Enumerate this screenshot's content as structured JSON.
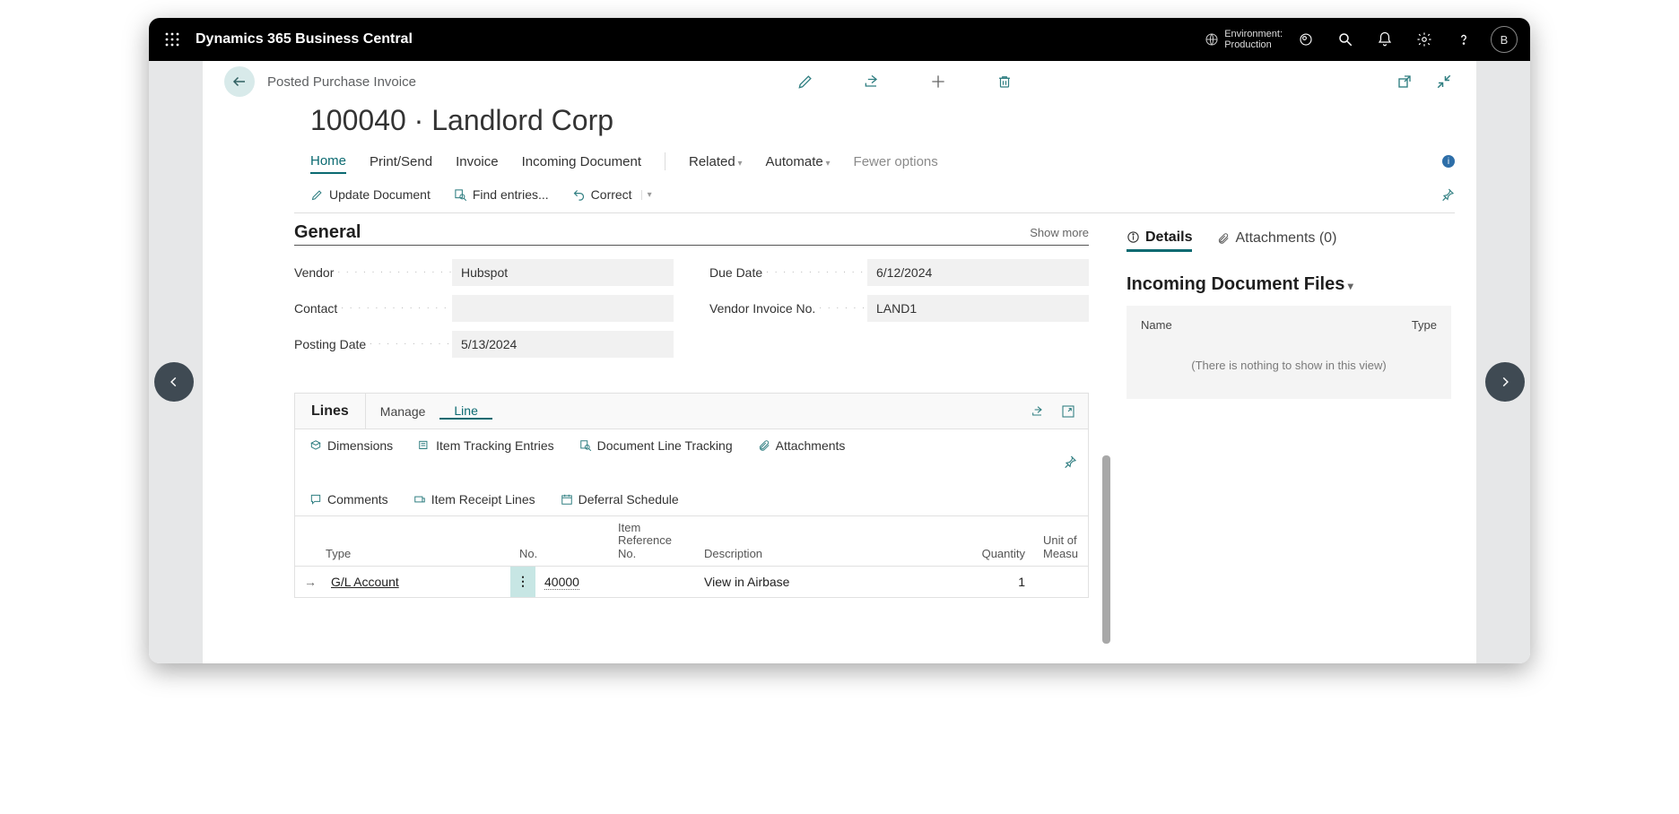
{
  "app_title": "Dynamics 365 Business Central",
  "env_label": "Environment:",
  "env_value": "Production",
  "avatar_letter": "B",
  "doc": {
    "type": "Posted Purchase Invoice",
    "title": "100040 · Landlord Corp"
  },
  "ribbon": {
    "home": "Home",
    "print_send": "Print/Send",
    "invoice": "Invoice",
    "incoming": "Incoming Document",
    "related": "Related",
    "automate": "Automate",
    "fewer": "Fewer options"
  },
  "subribbon": {
    "update": "Update Document",
    "find": "Find entries...",
    "correct": "Correct"
  },
  "general": {
    "title": "General",
    "show_more": "Show more",
    "vendor_label": "Vendor",
    "vendor_value": "Hubspot",
    "contact_label": "Contact",
    "contact_value": "",
    "posting_label": "Posting Date",
    "posting_value": "5/13/2024",
    "due_label": "Due Date",
    "due_value": "6/12/2024",
    "vinv_label": "Vendor Invoice No.",
    "vinv_value": "LAND1"
  },
  "lines": {
    "title": "Lines",
    "manage": "Manage",
    "line": "Line",
    "actions": {
      "dimensions": "Dimensions",
      "tracking": "Item Tracking Entries",
      "doc_line_tracking": "Document Line Tracking",
      "attachments": "Attachments",
      "comments": "Comments",
      "receipt": "Item Receipt Lines",
      "deferral": "Deferral Schedule"
    },
    "columns": {
      "type": "Type",
      "no": "No.",
      "item_ref": "Item\nReference\nNo.",
      "description": "Description",
      "quantity": "Quantity",
      "uom": "Unit of\nMeasu"
    },
    "rows": [
      {
        "type": "G/L Account",
        "no": "40000",
        "item_ref": "",
        "description": "View in Airbase",
        "quantity": "1",
        "uom": ""
      }
    ]
  },
  "right": {
    "details": "Details",
    "attachments": "Attachments (0)",
    "incoming_title": "Incoming Document Files",
    "col_name": "Name",
    "col_type": "Type",
    "empty": "(There is nothing to show in this view)"
  }
}
